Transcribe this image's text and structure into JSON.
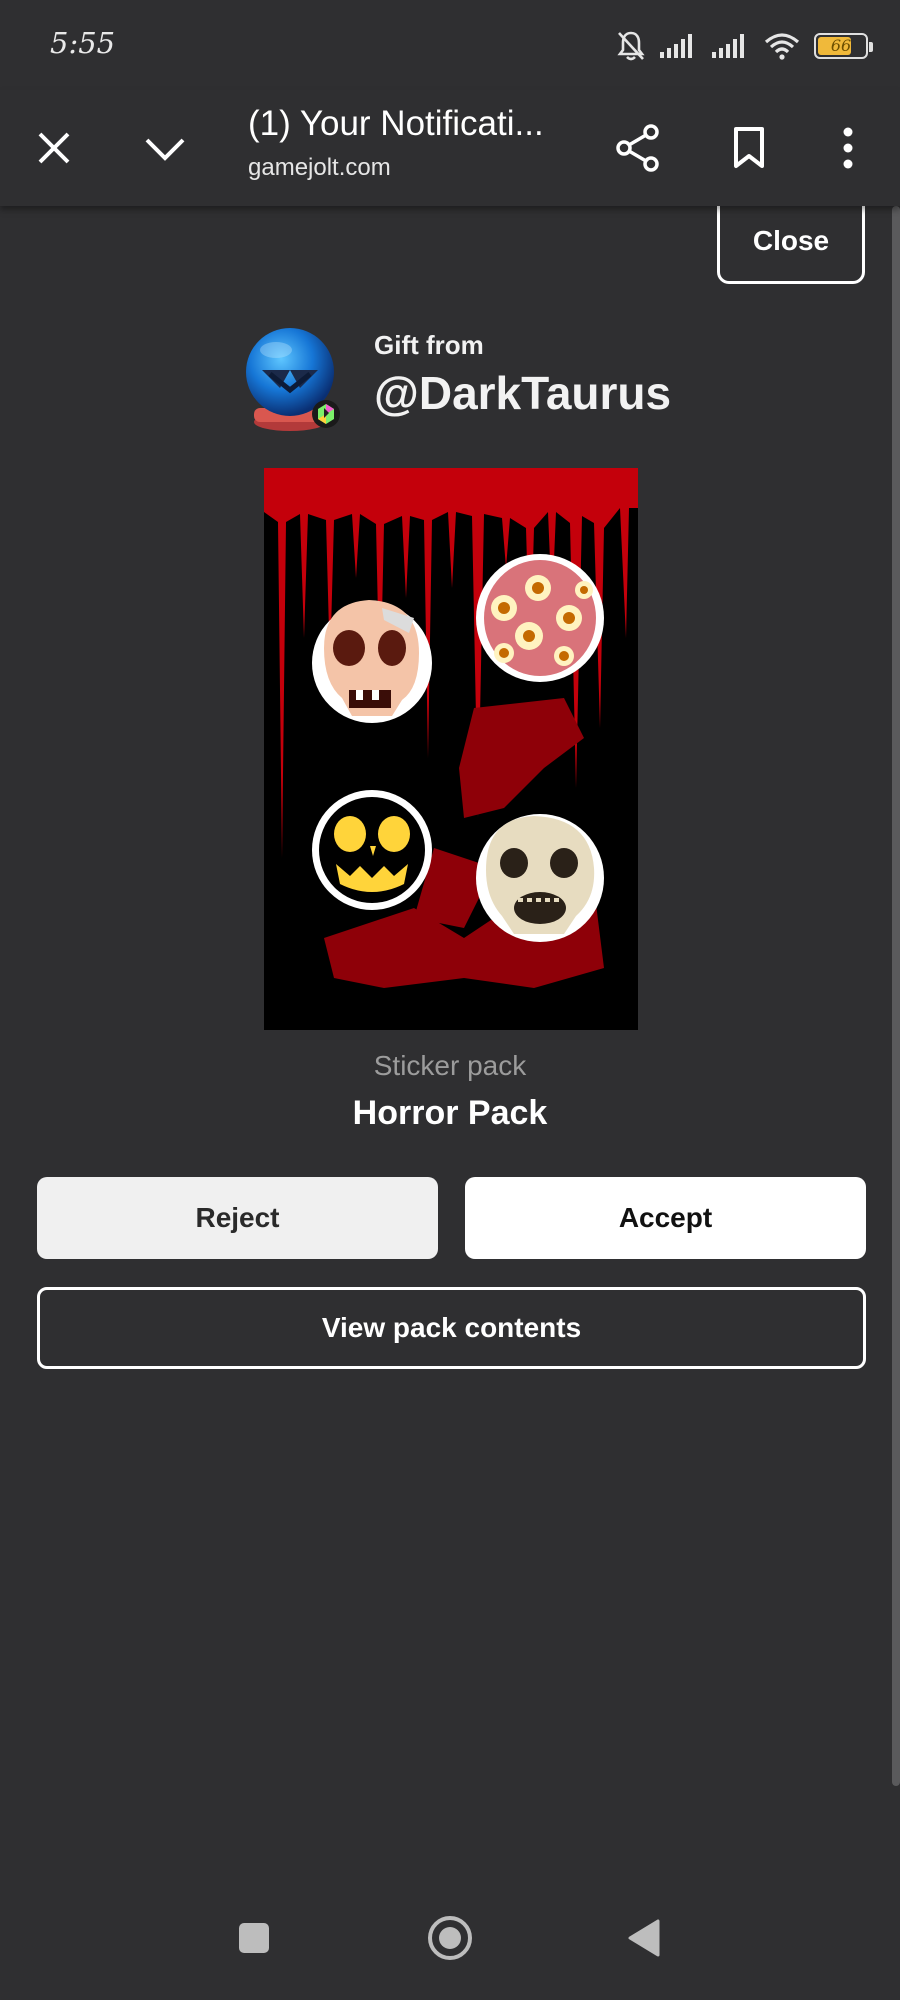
{
  "status_bar": {
    "time": "5:55",
    "battery_level": "66",
    "icons": [
      "mute-bell-icon",
      "signal-icon",
      "signal-icon",
      "wifi-icon",
      "battery-icon"
    ]
  },
  "browser": {
    "title": "(1) Your Notificati...",
    "url": "gamejolt.com",
    "icons": [
      "close-icon",
      "chevron-down-icon",
      "share-icon",
      "bookmark-icon",
      "more-vert-icon"
    ]
  },
  "dialog": {
    "close_label": "Close",
    "gift_from_label": "Gift from",
    "sender": "@DarkTaurus",
    "pack_type": "Sticker pack",
    "pack_name": "Horror Pack",
    "reject_label": "Reject",
    "accept_label": "Accept",
    "view_contents_label": "View pack contents"
  },
  "nav_bar": {
    "icons": [
      "recents-square-icon",
      "home-circle-icon",
      "back-triangle-icon"
    ]
  },
  "colors": {
    "background": "#2f2f31",
    "pack_red": "#c4000b",
    "battery": "#f0b93a"
  }
}
